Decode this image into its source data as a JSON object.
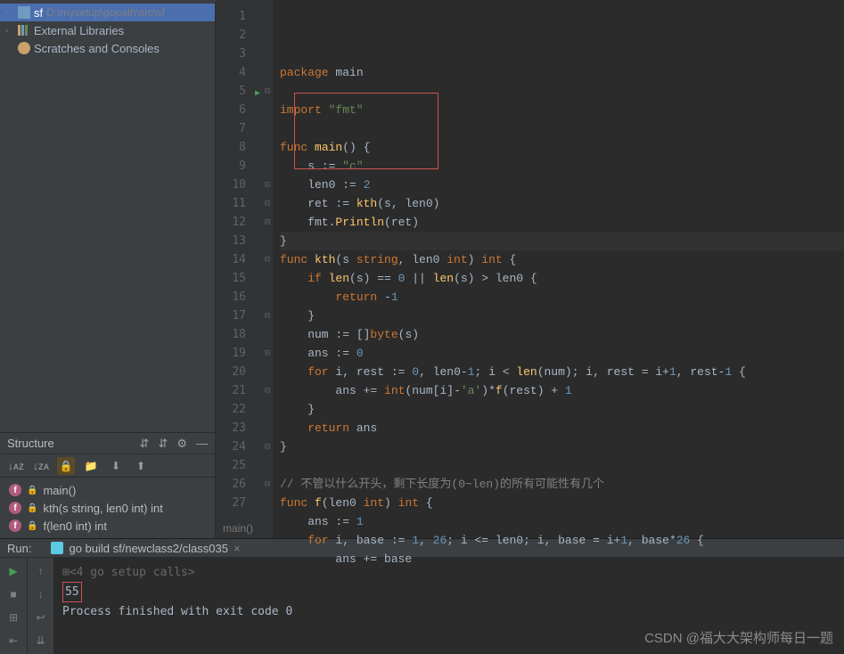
{
  "project": {
    "root_name": "sf",
    "root_path": "D:\\mysetup\\gopath\\src\\sf",
    "external_libs": "External Libraries",
    "scratches": "Scratches and Consoles"
  },
  "structure": {
    "title": "Structure",
    "items": [
      {
        "name": "main()"
      },
      {
        "name": "kth(s string, len0 int) int"
      },
      {
        "name": "f(len0 int) int"
      }
    ]
  },
  "editor": {
    "cursor_context": "main()",
    "lines": [
      {
        "n": 1,
        "tokens": [
          {
            "t": "package ",
            "c": "kw"
          },
          {
            "t": "main",
            "c": "id"
          }
        ]
      },
      {
        "n": 2,
        "tokens": []
      },
      {
        "n": 3,
        "tokens": [
          {
            "t": "import ",
            "c": "kw"
          },
          {
            "t": "\"fmt\"",
            "c": "str"
          }
        ]
      },
      {
        "n": 4,
        "tokens": []
      },
      {
        "n": 5,
        "run": true,
        "fold": "⊟",
        "tokens": [
          {
            "t": "func ",
            "c": "kw"
          },
          {
            "t": "main",
            "c": "fn"
          },
          {
            "t": "() {",
            "c": "id"
          }
        ]
      },
      {
        "n": 6,
        "tokens": [
          {
            "t": "    s := ",
            "c": "id"
          },
          {
            "t": "\"c\"",
            "c": "str"
          }
        ]
      },
      {
        "n": 7,
        "tokens": [
          {
            "t": "    len0 := ",
            "c": "id"
          },
          {
            "t": "2",
            "c": "num"
          }
        ]
      },
      {
        "n": 8,
        "tokens": [
          {
            "t": "    ret := ",
            "c": "id"
          },
          {
            "t": "kth",
            "c": "fn"
          },
          {
            "t": "(s, len0)",
            "c": "id"
          }
        ]
      },
      {
        "n": 9,
        "tokens": [
          {
            "t": "    fmt.",
            "c": "id"
          },
          {
            "t": "Println",
            "c": "fn"
          },
          {
            "t": "(ret)",
            "c": "id"
          }
        ]
      },
      {
        "n": 10,
        "hl": true,
        "fold": "⊟",
        "tokens": [
          {
            "t": "}",
            "c": "id"
          }
        ]
      },
      {
        "n": 11,
        "fold": "⊟",
        "tokens": [
          {
            "t": "func ",
            "c": "kw"
          },
          {
            "t": "kth",
            "c": "fn"
          },
          {
            "t": "(s ",
            "c": "id"
          },
          {
            "t": "string",
            "c": "typ"
          },
          {
            "t": ", len0 ",
            "c": "id"
          },
          {
            "t": "int",
            "c": "typ"
          },
          {
            "t": ") ",
            "c": "id"
          },
          {
            "t": "int",
            "c": "typ"
          },
          {
            "t": " {",
            "c": "id"
          }
        ]
      },
      {
        "n": 12,
        "fold": "⊟",
        "tokens": [
          {
            "t": "    if ",
            "c": "kw"
          },
          {
            "t": "len",
            "c": "fn"
          },
          {
            "t": "(s) == ",
            "c": "id"
          },
          {
            "t": "0",
            "c": "num"
          },
          {
            "t": " || ",
            "c": "id"
          },
          {
            "t": "len",
            "c": "fn"
          },
          {
            "t": "(s) > len0 {",
            "c": "id"
          }
        ]
      },
      {
        "n": 13,
        "tokens": [
          {
            "t": "        return ",
            "c": "kw"
          },
          {
            "t": "-",
            "c": "id"
          },
          {
            "t": "1",
            "c": "num"
          }
        ]
      },
      {
        "n": 14,
        "fold": "⊟",
        "tokens": [
          {
            "t": "    }",
            "c": "id"
          }
        ]
      },
      {
        "n": 15,
        "tokens": [
          {
            "t": "    num := []",
            "c": "id"
          },
          {
            "t": "byte",
            "c": "typ"
          },
          {
            "t": "(s)",
            "c": "id"
          }
        ]
      },
      {
        "n": 16,
        "tokens": [
          {
            "t": "    ans := ",
            "c": "id"
          },
          {
            "t": "0",
            "c": "num"
          }
        ]
      },
      {
        "n": 17,
        "fold": "⊟",
        "tokens": [
          {
            "t": "    for ",
            "c": "kw"
          },
          {
            "t": "i, rest := ",
            "c": "id"
          },
          {
            "t": "0",
            "c": "num"
          },
          {
            "t": ", len0-",
            "c": "id"
          },
          {
            "t": "1",
            "c": "num"
          },
          {
            "t": "; i < ",
            "c": "id"
          },
          {
            "t": "len",
            "c": "fn"
          },
          {
            "t": "(num); i, rest = i+",
            "c": "id"
          },
          {
            "t": "1",
            "c": "num"
          },
          {
            "t": ", rest-",
            "c": "id"
          },
          {
            "t": "1",
            "c": "num"
          },
          {
            "t": " {",
            "c": "id"
          }
        ]
      },
      {
        "n": 18,
        "tokens": [
          {
            "t": "        ans += ",
            "c": "id"
          },
          {
            "t": "int",
            "c": "typ"
          },
          {
            "t": "(num[i]-",
            "c": "id"
          },
          {
            "t": "'a'",
            "c": "str"
          },
          {
            "t": ")*",
            "c": "id"
          },
          {
            "t": "f",
            "c": "fn"
          },
          {
            "t": "(rest) + ",
            "c": "id"
          },
          {
            "t": "1",
            "c": "num"
          }
        ]
      },
      {
        "n": 19,
        "fold": "⊟",
        "tokens": [
          {
            "t": "    }",
            "c": "id"
          }
        ]
      },
      {
        "n": 20,
        "tokens": [
          {
            "t": "    return ",
            "c": "kw"
          },
          {
            "t": "ans",
            "c": "id"
          }
        ]
      },
      {
        "n": 21,
        "fold": "⊟",
        "tokens": [
          {
            "t": "}",
            "c": "id"
          }
        ]
      },
      {
        "n": 22,
        "tokens": []
      },
      {
        "n": 23,
        "tokens": [
          {
            "t": "// 不管以什么开头，剩下长度为(0~len)的所有可能性有几个",
            "c": "cm"
          }
        ]
      },
      {
        "n": 24,
        "fold": "⊟",
        "tokens": [
          {
            "t": "func ",
            "c": "kw"
          },
          {
            "t": "f",
            "c": "fn"
          },
          {
            "t": "(len0 ",
            "c": "id"
          },
          {
            "t": "int",
            "c": "typ"
          },
          {
            "t": ") ",
            "c": "id"
          },
          {
            "t": "int",
            "c": "typ"
          },
          {
            "t": " {",
            "c": "id"
          }
        ]
      },
      {
        "n": 25,
        "tokens": [
          {
            "t": "    ans := ",
            "c": "id"
          },
          {
            "t": "1",
            "c": "num"
          }
        ]
      },
      {
        "n": 26,
        "fold": "⊟",
        "tokens": [
          {
            "t": "    for ",
            "c": "kw"
          },
          {
            "t": "i, base := ",
            "c": "id"
          },
          {
            "t": "1",
            "c": "num"
          },
          {
            "t": ", ",
            "c": "id"
          },
          {
            "t": "26",
            "c": "num"
          },
          {
            "t": "; i <= len0; i, base = i+",
            "c": "id"
          },
          {
            "t": "1",
            "c": "num"
          },
          {
            "t": ", base*",
            "c": "id"
          },
          {
            "t": "26",
            "c": "num"
          },
          {
            "t": " {",
            "c": "id"
          }
        ]
      },
      {
        "n": 27,
        "tokens": [
          {
            "t": "        ans += base",
            "c": "id"
          }
        ]
      }
    ]
  },
  "run": {
    "label": "Run:",
    "tab": "go build sf/newclass2/class035",
    "setup_calls": "<4 go setup calls>",
    "output": "55",
    "exit_msg": "Process finished with exit code 0"
  },
  "watermark": "CSDN @福大大架构师每日一题"
}
